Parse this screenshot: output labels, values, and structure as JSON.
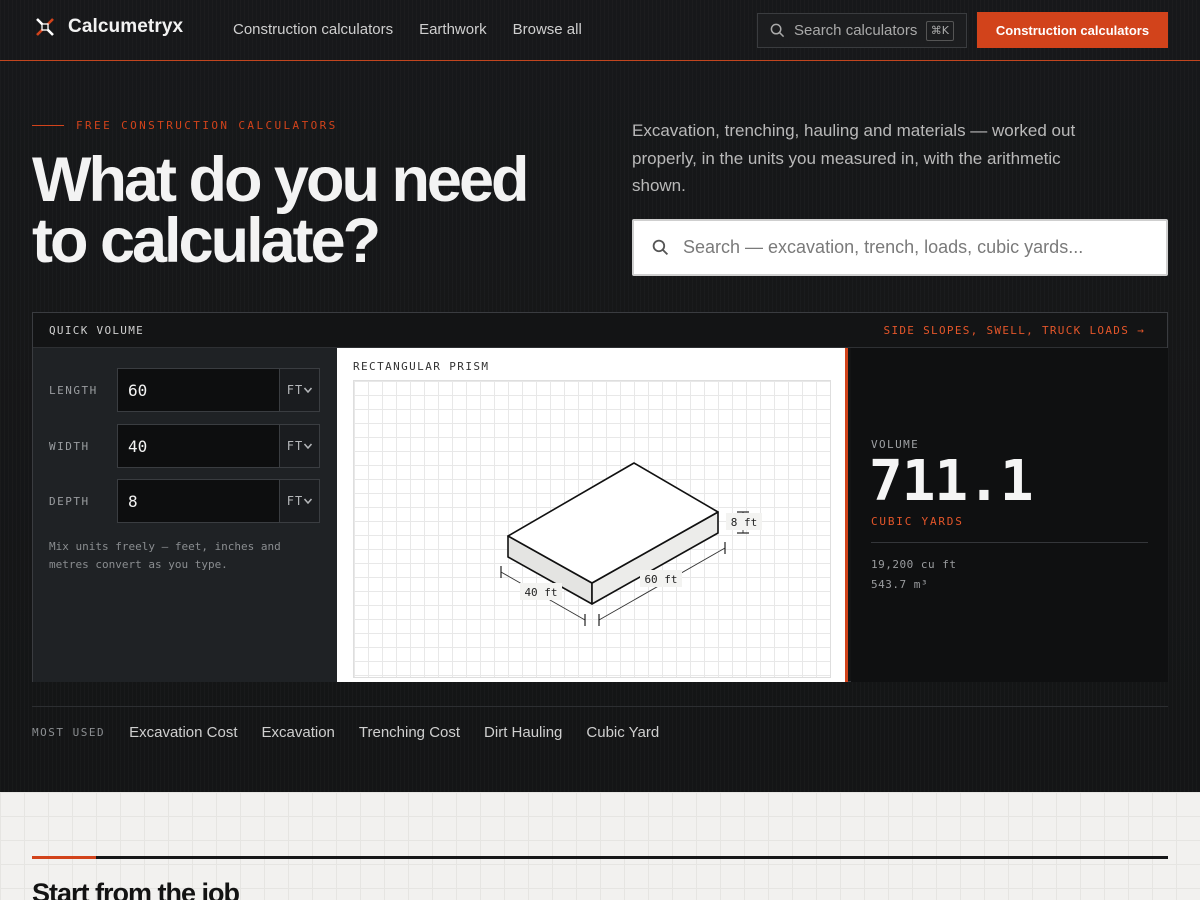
{
  "nav": {
    "brand": "Calcumetryx",
    "links": [
      "Construction calculators",
      "Earthwork",
      "Browse all"
    ],
    "search_label": "Search calculators",
    "search_shortcut": "⌘K",
    "cta": "Construction calculators"
  },
  "hero": {
    "eyebrow": "FREE CONSTRUCTION CALCULATORS",
    "title": "What do you need to calculate?",
    "description": "Excavation, trenching, hauling and materials — worked out properly, in the units you measured in, with the arithmetic shown.",
    "search_placeholder": "Search — excavation, trench, loads, cubic yards..."
  },
  "quick_volume": {
    "heading": "QUICK VOLUME",
    "link": "SIDE SLOPES, SWELL, TRUCK LOADS",
    "fields": [
      {
        "label": "LENGTH",
        "value": "60",
        "unit": "FT"
      },
      {
        "label": "WIDTH",
        "value": "40",
        "unit": "FT"
      },
      {
        "label": "DEPTH",
        "value": "8",
        "unit": "FT"
      }
    ],
    "note": "Mix units freely — feet, inches and metres convert as you type.",
    "diagram": {
      "title": "RECTANGULAR PRISM",
      "label_depth": "8 ft",
      "label_length": "60 ft",
      "label_width": "40 ft"
    },
    "result": {
      "label": "VOLUME",
      "value": "711.1",
      "unit": "CUBIC YARDS",
      "cubic_feet": "19,200 cu ft",
      "cubic_metres": "543.7 m³"
    }
  },
  "most_used": {
    "label": "MOST USED",
    "links": [
      "Excavation Cost",
      "Excavation",
      "Trenching Cost",
      "Dirt Hauling",
      "Cubic Yard"
    ]
  },
  "section": {
    "title": "Start from the job"
  },
  "colors": {
    "accent": "#d2431b",
    "background": "#161718"
  }
}
